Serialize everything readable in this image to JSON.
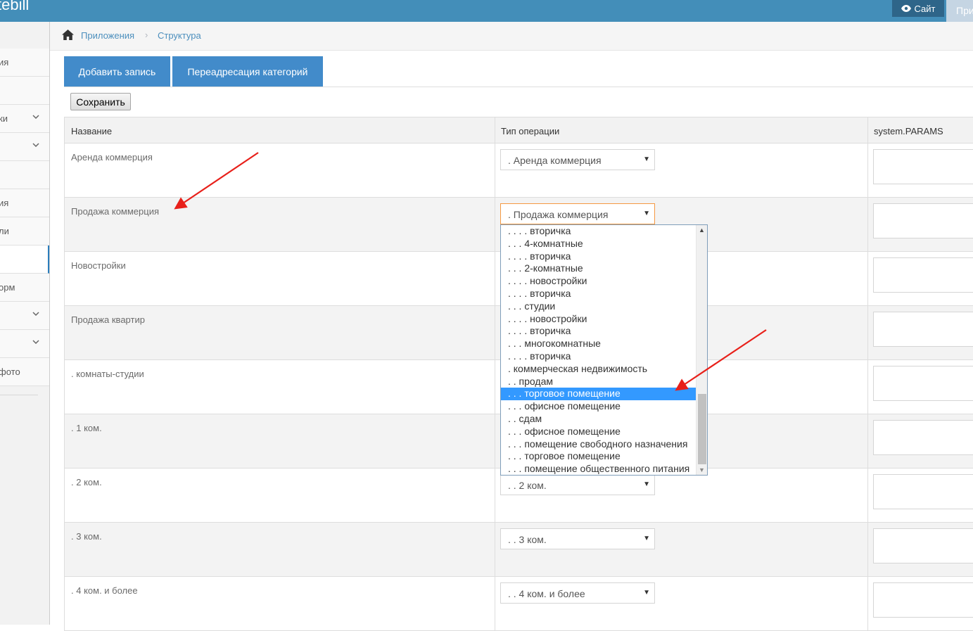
{
  "app": {
    "brand": "tebill"
  },
  "topbar": {
    "site_label": "Сайт",
    "app_label": "Приложения"
  },
  "sidebar": {
    "items": [
      {
        "label": "ия",
        "chevron": false
      },
      {
        "label": "",
        "chevron": false
      },
      {
        "label": "ки",
        "chevron": true
      },
      {
        "label": "",
        "chevron": true
      },
      {
        "label": "",
        "chevron": false
      },
      {
        "label": "ия",
        "chevron": false
      },
      {
        "label": "ли",
        "chevron": false
      },
      {
        "label": "",
        "chevron": false,
        "active": true
      },
      {
        "label": "орм",
        "chevron": false
      },
      {
        "label": "",
        "chevron": true
      },
      {
        "label": "",
        "chevron": true
      },
      {
        "label": "фото",
        "chevron": false
      }
    ]
  },
  "breadcrumb": {
    "item1": "Приложения",
    "separator": "›",
    "item2": "Структура"
  },
  "actions": {
    "add_record": "Добавить запись",
    "redirect": "Переадресация категорий",
    "save": "Сохранить"
  },
  "table": {
    "headers": {
      "name": "Название",
      "type": "Тип операции",
      "params": "system.PARAMS"
    },
    "rows": [
      {
        "name": "Аренда коммерция",
        "select": ". Аренда коммерция"
      },
      {
        "name": "Продажа коммерция",
        "select": ". Продажа коммерция"
      },
      {
        "name": "Новостройки",
        "select": ""
      },
      {
        "name": "Продажа квартир",
        "select": ""
      },
      {
        "name": ". комнаты-студии",
        "select": ""
      },
      {
        "name": ". 1 ком.",
        "select": ""
      },
      {
        "name": ". 2 ком.",
        "select": ". . 2 ком."
      },
      {
        "name": ". 3 ком.",
        "select": ". . 3 ком."
      },
      {
        "name": ". 4 ком. и более",
        "select": ". . 4 ком. и более"
      }
    ]
  },
  "dropdown": {
    "options": [
      ". . . . вторичка",
      ". . . 4-комнатные",
      ". . . . вторичка",
      ". . . 2-комнатные",
      ". . . . новостройки",
      ". . . . вторичка",
      ". . . студии",
      ". . . . новостройки",
      ". . . . вторичка",
      ". . . многокомнатные",
      ". . . . вторичка",
      ". коммерческая недвижимость",
      ". . продам",
      ". . . торговое помещение",
      ". . . офисное помещение",
      ". . сдам",
      ". . . офисное помещение",
      ". . . помещение свободного назначения",
      ". . . торговое помещение",
      ". . . помещение общественного питания"
    ],
    "selected_index": 13
  },
  "colors": {
    "topbar": "#438eb9",
    "button": "#428bca",
    "selected": "#3399ff",
    "arrow": "#e8201a"
  }
}
